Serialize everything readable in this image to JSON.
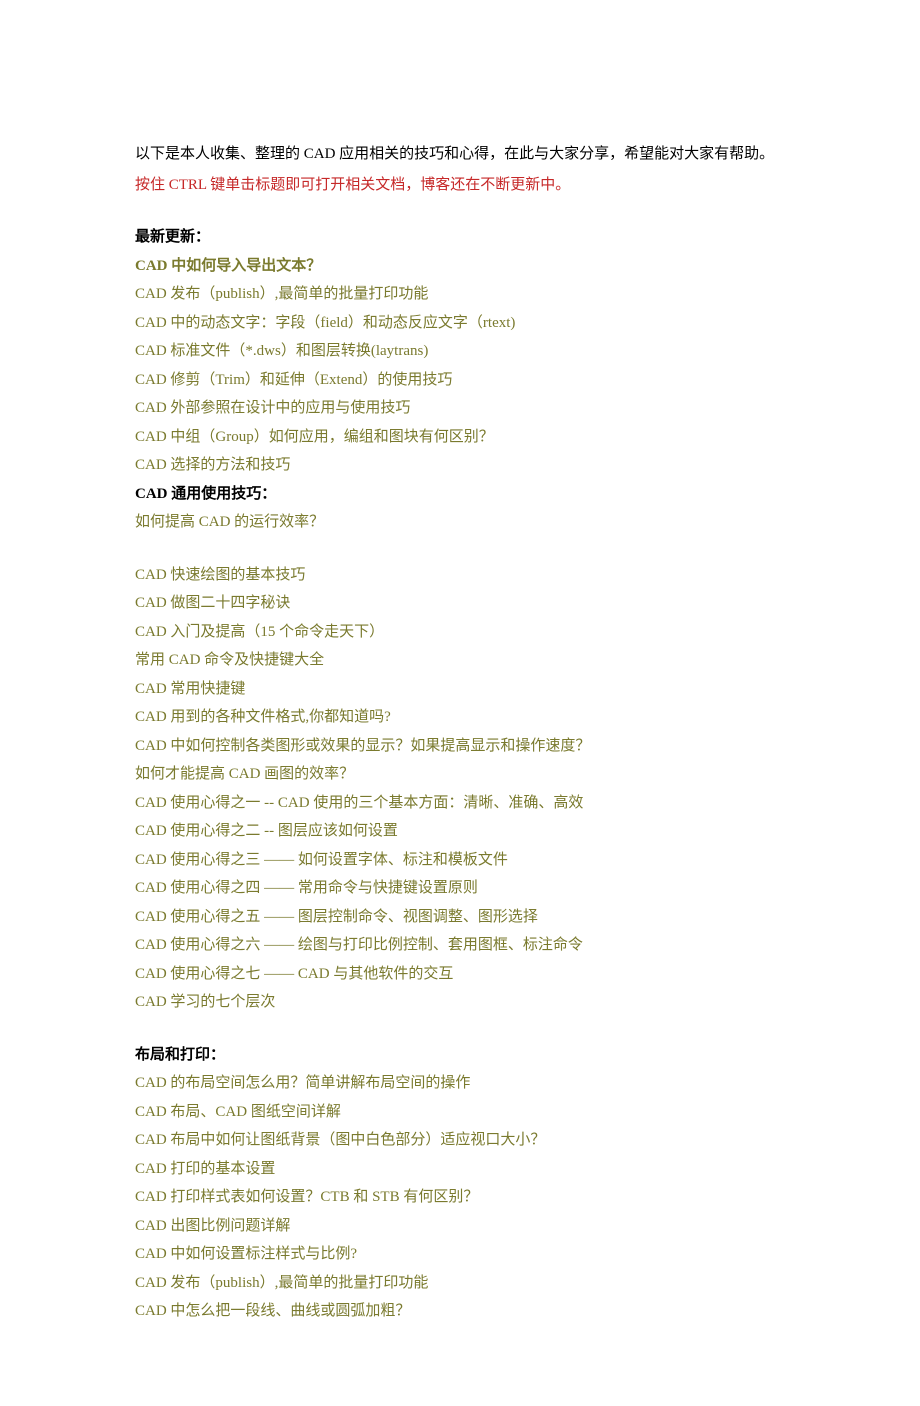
{
  "intro": "以下是本人收集、整理的 CAD 应用相关的技巧和心得，在此与大家分享，希望能对大家有帮助。",
  "notice": "按住 CTRL 键单击标题即可打开相关文档，博客还在不断更新中。",
  "section_latest_title": "最新更新：",
  "latest_bold": "CAD 中如何导入导出文本？",
  "latest": [
    "CAD 发布（publish）,最简单的批量打印功能",
    "CAD 中的动态文字：字段（field）和动态反应文字（rtext)",
    "CAD 标准文件（*.dws）和图层转换(laytrans)",
    "CAD 修剪（Trim）和延伸（Extend）的使用技巧",
    "CAD 外部参照在设计中的应用与使用技巧",
    "CAD 中组（Group）如何应用，编组和图块有何区别？",
    "CAD 选择的方法和技巧"
  ],
  "section_general_title": "CAD 通用使用技巧：",
  "general_first": "如何提高 CAD 的运行效率？",
  "general": [
    "CAD 快速绘图的基本技巧",
    "CAD 做图二十四字秘诀",
    "CAD 入门及提高（15 个命令走天下）",
    "常用 CAD 命令及快捷键大全",
    "CAD 常用快捷键",
    "CAD 用到的各种文件格式,你都知道吗?",
    "CAD 中如何控制各类图形或效果的显示？如果提高显示和操作速度？",
    "如何才能提高 CAD 画图的效率？",
    "CAD 使用心得之一  --  CAD 使用的三个基本方面：清晰、准确、高效",
    "CAD 使用心得之二  --  图层应该如何设置",
    "CAD 使用心得之三  ——  如何设置字体、标注和模板文件",
    "CAD 使用心得之四  ——  常用命令与快捷键设置原则",
    "CAD 使用心得之五  ——  图层控制命令、视图调整、图形选择",
    "CAD 使用心得之六  ——  绘图与打印比例控制、套用图框、标注命令",
    "CAD 使用心得之七  ——  CAD 与其他软件的交互",
    "CAD 学习的七个层次"
  ],
  "section_layout_title": "布局和打印：",
  "layout": [
    "CAD 的布局空间怎么用？简单讲解布局空间的操作",
    "CAD 布局、CAD 图纸空间详解",
    "CAD 布局中如何让图纸背景（图中白色部分）适应视口大小？",
    "CAD 打印的基本设置",
    "CAD 打印样式表如何设置？CTB 和 STB 有何区别？",
    "CAD 出图比例问题详解",
    "CAD 中如何设置标注样式与比例?",
    "CAD 发布（publish）,最简单的批量打印功能",
    "CAD 中怎么把一段线、曲线或圆弧加粗？"
  ]
}
